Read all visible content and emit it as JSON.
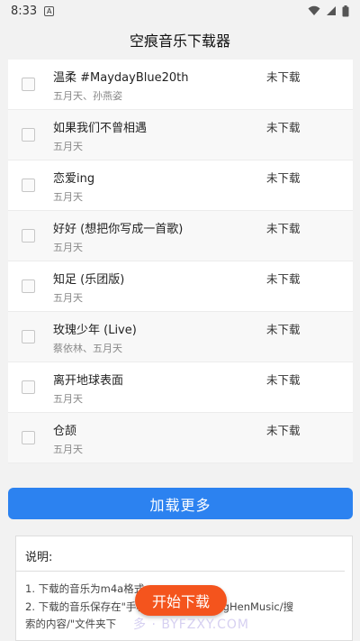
{
  "status_bar": {
    "time": "8:33",
    "notification_letter": "A"
  },
  "app": {
    "title": "空痕音乐下载器"
  },
  "songs": [
    {
      "title": "温柔 #MaydayBlue20th",
      "artist": "五月天、孙燕姿",
      "status": "未下载"
    },
    {
      "title": "如果我们不曾相遇",
      "artist": "五月天",
      "status": "未下载"
    },
    {
      "title": "恋爱ing",
      "artist": "五月天",
      "status": "未下载"
    },
    {
      "title": "好好 (想把你写成一首歌)",
      "artist": "五月天",
      "status": "未下载"
    },
    {
      "title": "知足 (乐团版)",
      "artist": "五月天",
      "status": "未下载"
    },
    {
      "title": "玫瑰少年 (Live)",
      "artist": "蔡依林、五月天",
      "status": "未下载"
    },
    {
      "title": "离开地球表面",
      "artist": "五月天",
      "status": "未下载"
    },
    {
      "title": "仓颉",
      "artist": "五月天",
      "status": "未下载"
    }
  ],
  "load_more_label": "加载更多",
  "notes": {
    "title": "说明:",
    "line1": "1. 下载的音乐为m4a格式",
    "line2": "2. 下载的音乐保存在\"手机存储/Music/KongHenMusic/搜",
    "line3": "索的内容/\"文件夹下"
  },
  "start_download_label": "开始下载",
  "watermark": "多 · BYFZXY.COM",
  "colors": {
    "primary": "#2c82f0",
    "accent": "#f4541d"
  }
}
